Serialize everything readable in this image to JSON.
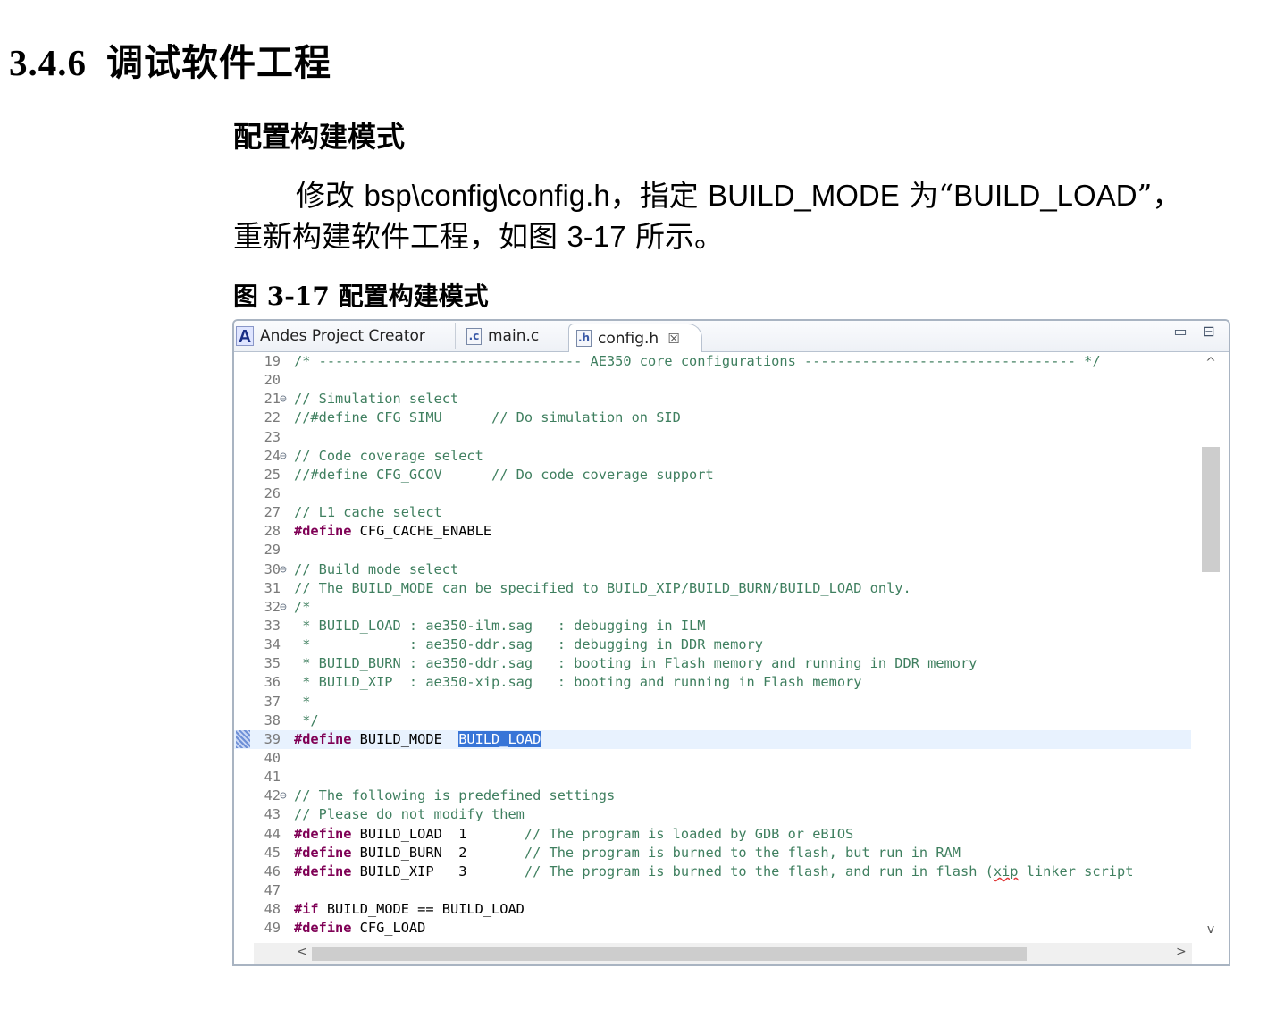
{
  "section": {
    "number": "3.4.6",
    "title": "调试软件工程"
  },
  "subsection": {
    "title": "配置构建模式"
  },
  "paragraph": {
    "line1_a": "修改 ",
    "line1_b": "bsp\\config\\config.h",
    "line1_c": "，指定 ",
    "line1_d": "BUILD_MODE",
    "line1_e": " 为“",
    "line1_f": "BUILD_LOAD",
    "line1_g": "”，",
    "line2_a": "重新构建软件工程，如图 ",
    "line2_b": "3-17",
    "line2_c": " 所示。"
  },
  "figure": {
    "caption": "图 3-17 配置构建模式"
  },
  "editor": {
    "tabs": [
      {
        "label": "Andes Project Creator",
        "icon": "andes-a-icon"
      },
      {
        "label": "main.c",
        "icon": "c-file-icon"
      },
      {
        "label": "config.h",
        "icon": "h-file-icon",
        "active": true
      }
    ],
    "close_glyph": "☒",
    "minimize_glyph": "▭",
    "maximize_glyph": "⊟",
    "current_line": 39,
    "lines": [
      {
        "n": "19",
        "fold": "",
        "parts": [
          [
            "comment",
            "/* -------------------------------- AE350 core configurations --------------------------------- */"
          ]
        ]
      },
      {
        "n": "20",
        "fold": "",
        "parts": []
      },
      {
        "n": "21",
        "fold": "⊖",
        "parts": [
          [
            "comment",
            "// Simulation select"
          ]
        ]
      },
      {
        "n": "22",
        "fold": "",
        "parts": [
          [
            "comment",
            "//#define CFG_SIMU      // Do simulation on SID"
          ]
        ]
      },
      {
        "n": "23",
        "fold": "",
        "parts": []
      },
      {
        "n": "24",
        "fold": "⊖",
        "parts": [
          [
            "comment",
            "// Code coverage select"
          ]
        ]
      },
      {
        "n": "25",
        "fold": "",
        "parts": [
          [
            "comment",
            "//#define CFG_GCOV      // Do code coverage support"
          ]
        ]
      },
      {
        "n": "26",
        "fold": "",
        "parts": []
      },
      {
        "n": "27",
        "fold": "",
        "parts": [
          [
            "comment",
            "// L1 cache select"
          ]
        ]
      },
      {
        "n": "28",
        "fold": "",
        "parts": [
          [
            "kw",
            "#define"
          ],
          [
            "text",
            " CFG_CACHE_ENABLE"
          ]
        ]
      },
      {
        "n": "29",
        "fold": "",
        "parts": []
      },
      {
        "n": "30",
        "fold": "⊖",
        "parts": [
          [
            "comment",
            "// Build mode select"
          ]
        ]
      },
      {
        "n": "31",
        "fold": "",
        "parts": [
          [
            "comment",
            "// The BUILD_MODE can be specified to BUILD_XIP/BUILD_BURN/BUILD_LOAD only."
          ]
        ]
      },
      {
        "n": "32",
        "fold": "⊖",
        "parts": [
          [
            "comment",
            "/*"
          ]
        ]
      },
      {
        "n": "33",
        "fold": "",
        "parts": [
          [
            "comment",
            " * BUILD_LOAD : ae350-ilm.sag   : debugging in ILM"
          ]
        ]
      },
      {
        "n": "34",
        "fold": "",
        "parts": [
          [
            "comment",
            " *            : ae350-ddr.sag   : debugging in DDR memory"
          ]
        ]
      },
      {
        "n": "35",
        "fold": "",
        "parts": [
          [
            "comment",
            " * BUILD_BURN : ae350-ddr.sag   : booting in Flash memory and running in DDR memory"
          ]
        ]
      },
      {
        "n": "36",
        "fold": "",
        "parts": [
          [
            "comment",
            " * BUILD_XIP  : ae350-xip.sag   : booting and running in Flash memory"
          ]
        ]
      },
      {
        "n": "37",
        "fold": "",
        "parts": [
          [
            "comment",
            " *"
          ]
        ]
      },
      {
        "n": "38",
        "fold": "",
        "parts": [
          [
            "comment",
            " */"
          ]
        ]
      },
      {
        "n": "39",
        "fold": "",
        "parts": [
          [
            "kw",
            "#define"
          ],
          [
            "text",
            " BUILD_MODE  "
          ],
          [
            "sel",
            "BUILD_LOAD"
          ]
        ]
      },
      {
        "n": "40",
        "fold": "",
        "parts": []
      },
      {
        "n": "41",
        "fold": "",
        "parts": []
      },
      {
        "n": "42",
        "fold": "⊖",
        "parts": [
          [
            "comment",
            "// The following is predefined settings"
          ]
        ]
      },
      {
        "n": "43",
        "fold": "",
        "parts": [
          [
            "comment",
            "// Please do not modify them"
          ]
        ]
      },
      {
        "n": "44",
        "fold": "",
        "parts": [
          [
            "kw",
            "#define"
          ],
          [
            "text",
            " BUILD_LOAD  1       "
          ],
          [
            "comment",
            "// The program is loaded by GDB or eBIOS"
          ]
        ]
      },
      {
        "n": "45",
        "fold": "",
        "parts": [
          [
            "kw",
            "#define"
          ],
          [
            "text",
            " BUILD_BURN  2       "
          ],
          [
            "comment",
            "// The program is burned to the flash, but run in RAM"
          ]
        ]
      },
      {
        "n": "46",
        "fold": "",
        "parts": [
          [
            "kw",
            "#define"
          ],
          [
            "text",
            " BUILD_XIP   3       "
          ],
          [
            "comment",
            "// The program is burned to the flash, and run in flash ("
          ],
          [
            "squiggle",
            "xip"
          ],
          [
            "comment",
            " linker script"
          ]
        ]
      },
      {
        "n": "47",
        "fold": "",
        "parts": []
      },
      {
        "n": "48",
        "fold": "",
        "parts": [
          [
            "kw",
            "#if"
          ],
          [
            "text",
            " BUILD_MODE == BUILD_LOAD"
          ]
        ]
      },
      {
        "n": "49",
        "fold": "",
        "parts": [
          [
            "kw",
            "#define"
          ],
          [
            "text",
            " CFG_LOAD"
          ]
        ]
      }
    ],
    "scroll_up": "^",
    "scroll_down": "v",
    "scroll_left": "<",
    "scroll_right": ">"
  }
}
